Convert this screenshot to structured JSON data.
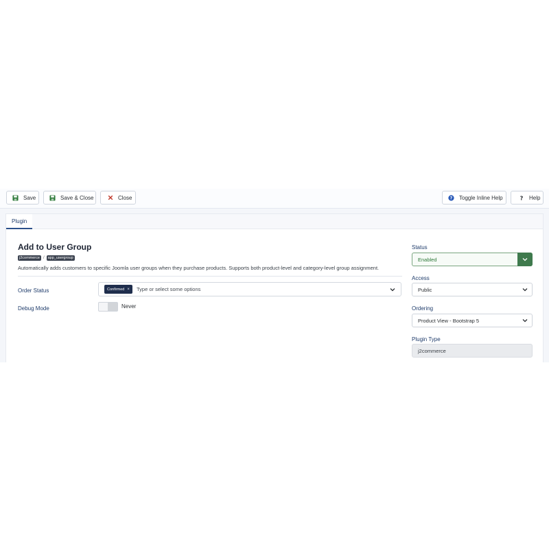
{
  "toolbar": {
    "save_label": "Save",
    "save_close_label": "Save & Close",
    "close_label": "Close",
    "toggle_help_label": "Toggle Inline Help",
    "help_label": "Help"
  },
  "tabs": [
    {
      "label": "Plugin",
      "active": true
    }
  ],
  "plugin": {
    "title": "Add to User Group",
    "badges": [
      "j2commerce",
      "app_usergroup"
    ],
    "badge_separator": "/",
    "description": "Automatically adds customers to specific Joomla user groups when they purchase products. Supports both product-level and category-level group assignment."
  },
  "fields": {
    "order_status": {
      "label": "Order Status",
      "chips": [
        {
          "label": "Confirmed",
          "remove_glyph": "×"
        }
      ],
      "placeholder": "Type or select some options"
    },
    "debug_mode": {
      "label": "Debug Mode",
      "value_text": "Never",
      "enabled": false
    }
  },
  "sidebar": {
    "status": {
      "label": "Status",
      "value": "Enabled"
    },
    "access": {
      "label": "Access",
      "value": "Public"
    },
    "ordering": {
      "label": "Ordering",
      "value": "Product View - Bootstrap 5"
    },
    "plugin_type": {
      "label": "Plugin Type",
      "value": "j2commerce"
    }
  },
  "colors": {
    "save_icon": "#2f7a3a",
    "close_icon": "#c0392b",
    "help_icon": "#2a5ab8",
    "status_accent": "#3f7a4d",
    "chip_bg": "#1f2e4d"
  },
  "icons": {
    "save": "floppy-disk-icon",
    "close": "x-icon",
    "toggle_help": "question-circle-icon",
    "help": "question-icon",
    "dropdown": "chevron-down-icon"
  }
}
